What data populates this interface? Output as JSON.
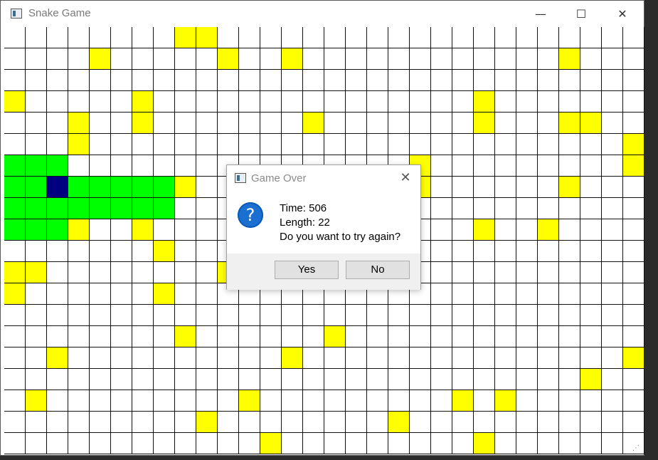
{
  "window": {
    "title": "Snake Game",
    "minimize_glyph": "—",
    "maximize_glyph": "☐",
    "close_glyph": "✕"
  },
  "board": {
    "columns": 30,
    "rows": 20,
    "colors": {
      "empty": "#ffffff",
      "food": "#ffff00",
      "snake_body": "#00ff00",
      "snake_head": "#000080",
      "gridline": "#111111"
    },
    "food_cells": [
      [
        8,
        0
      ],
      [
        9,
        0
      ],
      [
        4,
        1
      ],
      [
        10,
        1
      ],
      [
        13,
        1
      ],
      [
        26,
        1
      ],
      [
        0,
        3
      ],
      [
        6,
        3
      ],
      [
        22,
        3
      ],
      [
        3,
        4
      ],
      [
        6,
        4
      ],
      [
        14,
        4
      ],
      [
        22,
        4
      ],
      [
        26,
        4
      ],
      [
        27,
        4
      ],
      [
        3,
        5
      ],
      [
        29,
        5
      ],
      [
        19,
        6
      ],
      [
        29,
        6
      ],
      [
        8,
        7
      ],
      [
        19,
        7
      ],
      [
        26,
        7
      ],
      [
        3,
        9
      ],
      [
        6,
        9
      ],
      [
        22,
        9
      ],
      [
        25,
        9
      ],
      [
        7,
        10
      ],
      [
        0,
        11
      ],
      [
        1,
        11
      ],
      [
        10,
        11
      ],
      [
        0,
        12
      ],
      [
        7,
        12
      ],
      [
        8,
        14
      ],
      [
        15,
        14
      ],
      [
        2,
        15
      ],
      [
        13,
        15
      ],
      [
        29,
        15
      ],
      [
        27,
        16
      ],
      [
        1,
        17
      ],
      [
        11,
        17
      ],
      [
        21,
        17
      ],
      [
        23,
        17
      ],
      [
        9,
        18
      ],
      [
        18,
        18
      ],
      [
        12,
        19
      ],
      [
        22,
        19
      ]
    ],
    "snake_head": [
      2,
      7
    ],
    "snake_body": [
      [
        0,
        6
      ],
      [
        1,
        6
      ],
      [
        2,
        6
      ],
      [
        0,
        7
      ],
      [
        1,
        7
      ],
      [
        3,
        7
      ],
      [
        4,
        7
      ],
      [
        5,
        7
      ],
      [
        6,
        7
      ],
      [
        7,
        7
      ],
      [
        0,
        8
      ],
      [
        1,
        8
      ],
      [
        2,
        8
      ],
      [
        3,
        8
      ],
      [
        4,
        8
      ],
      [
        5,
        8
      ],
      [
        6,
        8
      ],
      [
        7,
        8
      ],
      [
        0,
        9
      ],
      [
        1,
        9
      ],
      [
        2,
        9
      ]
    ]
  },
  "dialog": {
    "title": "Game Over",
    "icon": "question-icon",
    "icon_glyph": "?",
    "close_glyph": "✕",
    "line_time": "Time: 506",
    "line_length": "Length: 22",
    "line_prompt": "Do you want to try again?",
    "yes_label": "Yes",
    "no_label": "No"
  }
}
